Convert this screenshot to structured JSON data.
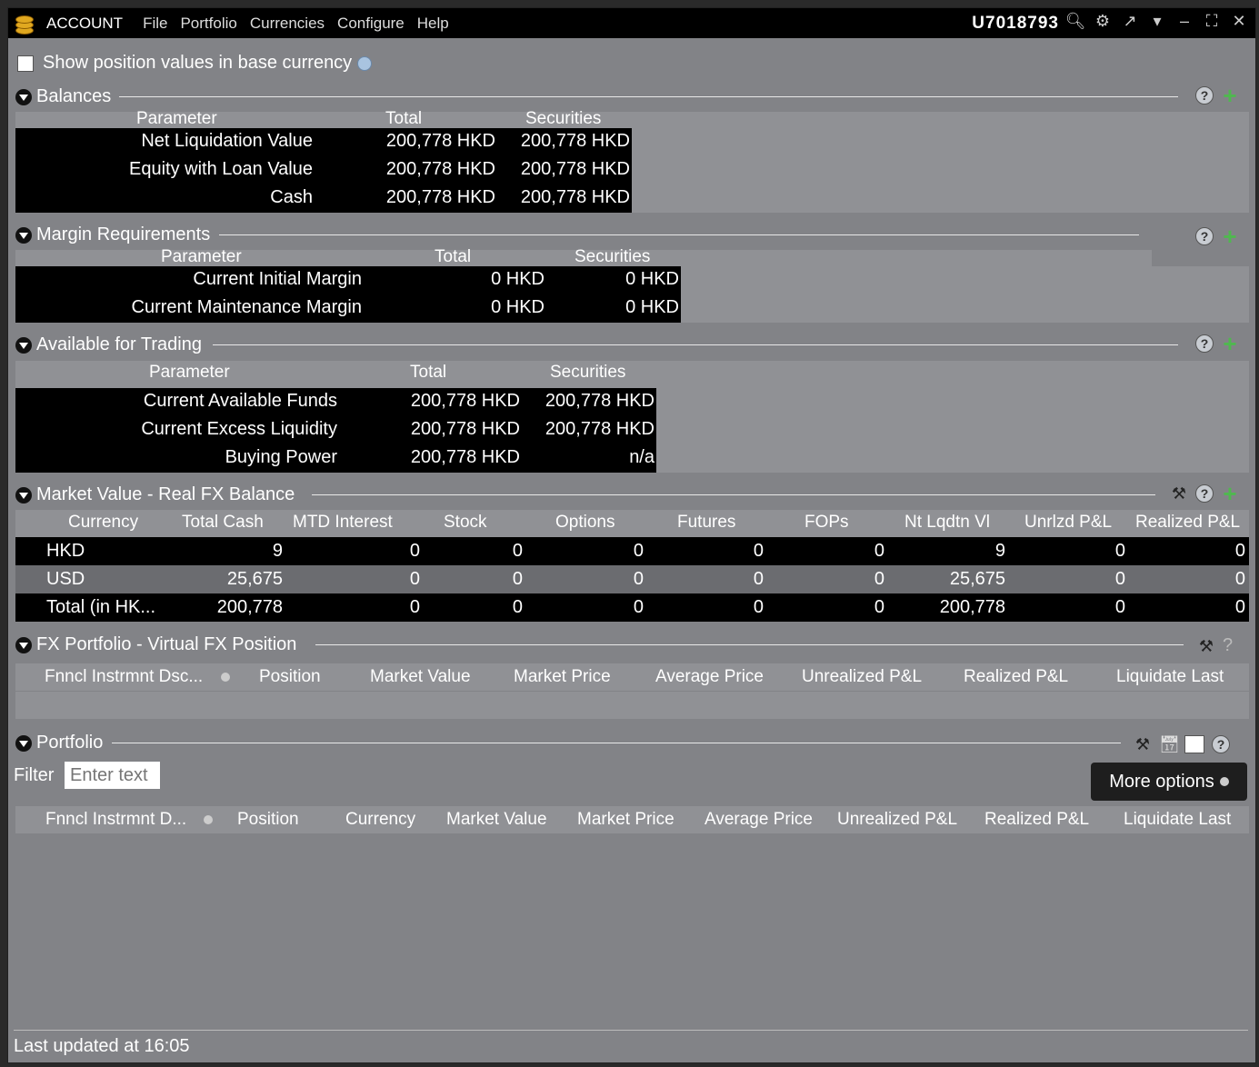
{
  "window": {
    "app_title": "ACCOUNT",
    "menu": [
      "File",
      "Portfolio",
      "Currencies",
      "Configure",
      "Help"
    ],
    "account_id": "U7018793"
  },
  "options": {
    "show_base_currency_label": "Show position values in base currency"
  },
  "balances": {
    "title": "Balances",
    "headers": [
      "Parameter",
      "Total",
      "Securities"
    ],
    "rows": [
      [
        "Net Liquidation Value",
        "200,778 HKD",
        "200,778 HKD"
      ],
      [
        "Equity with Loan Value",
        "200,778 HKD",
        "200,778 HKD"
      ],
      [
        "Cash",
        "200,778 HKD",
        "200,778 HKD"
      ]
    ]
  },
  "margin": {
    "title": "Margin Requirements",
    "headers": [
      "Parameter",
      "Total",
      "Securities"
    ],
    "rows": [
      [
        "Current Initial Margin",
        "0 HKD",
        "0 HKD"
      ],
      [
        "Current Maintenance Margin",
        "0 HKD",
        "0 HKD"
      ]
    ]
  },
  "available": {
    "title": "Available for Trading",
    "headers": [
      "Parameter",
      "Total",
      "Securities"
    ],
    "rows": [
      [
        "Current Available Funds",
        "200,778 HKD",
        "200,778 HKD"
      ],
      [
        "Current Excess Liquidity",
        "200,778 HKD",
        "200,778 HKD"
      ],
      [
        "Buying Power",
        "200,778 HKD",
        "n/a"
      ]
    ]
  },
  "market_value": {
    "title": "Market Value - Real FX Balance",
    "headers": [
      "Currency",
      "Total Cash",
      "MTD Interest",
      "Stock",
      "Options",
      "Futures",
      "FOPs",
      "Nt Lqdtn Vl",
      "Unrlzd P&L",
      "Realized P&L"
    ],
    "rows": [
      [
        "HKD",
        "9",
        "0",
        "0",
        "0",
        "0",
        "0",
        "9",
        "0",
        "0"
      ],
      [
        "USD",
        "25,675",
        "0",
        "0",
        "0",
        "0",
        "0",
        "25,675",
        "0",
        "0"
      ],
      [
        "Total (in HK...",
        "200,778",
        "0",
        "0",
        "0",
        "0",
        "0",
        "200,778",
        "0",
        "0"
      ]
    ]
  },
  "fx_portfolio": {
    "title": "FX Portfolio - Virtual FX Position",
    "headers": [
      "Fnncl Instrmnt Dsc...",
      "Position",
      "Market Value",
      "Market Price",
      "Average Price",
      "Unrealized P&L",
      "Realized P&L",
      "Liquidate Last"
    ],
    "question": "?"
  },
  "portfolio": {
    "title": "Portfolio",
    "filter_label": "Filter",
    "filter_placeholder": "Enter text",
    "more_options": "More options",
    "headers": [
      "Fnncl Instrmnt D...",
      "Position",
      "Currency",
      "Market Value",
      "Market Price",
      "Average Price",
      "Unrealized P&L",
      "Realized P&L",
      "Liquidate Last"
    ]
  },
  "status": {
    "last_updated": "Last updated at 16:05"
  },
  "colors": {
    "window_bg": "#828387",
    "band": "#909195",
    "table_black": "#000000",
    "row_gray": "#6b6c70",
    "plus_green": "#4fb84f"
  }
}
